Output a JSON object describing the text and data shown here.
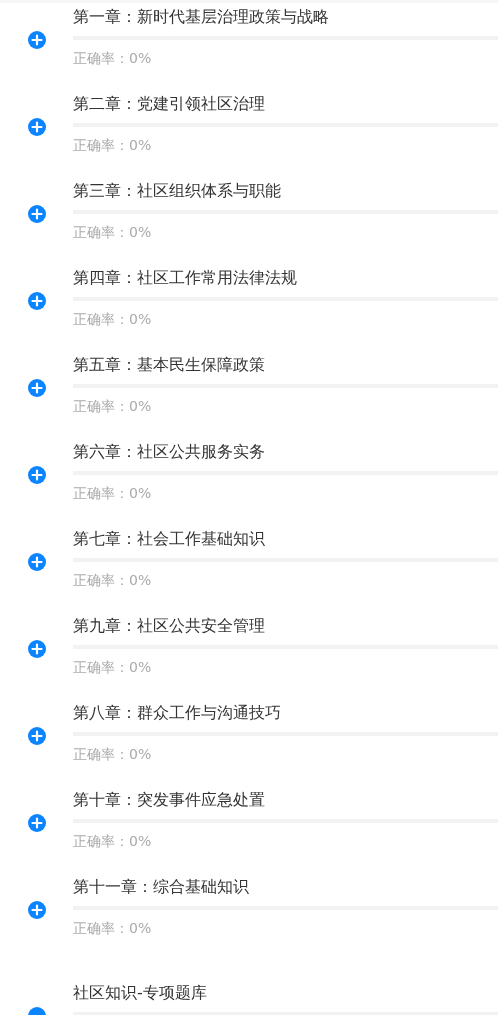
{
  "chapters": [
    {
      "kind": "plus",
      "title": "第一章：新时代基层治理政策与战略",
      "level": 0,
      "accuracy": "正确率：0%"
    },
    {
      "kind": "plus",
      "title": "第二章：党建引领社区治理",
      "level": 0,
      "accuracy": "正确率：0%"
    },
    {
      "kind": "plus",
      "title": "第三章：社区组织体系与职能",
      "level": 0,
      "accuracy": "正确率：0%"
    },
    {
      "kind": "plus",
      "title": "第四章：社区工作常用法律法规",
      "level": 0,
      "accuracy": "正确率：0%"
    },
    {
      "kind": "plus",
      "title": "第五章：基本民生保障政策",
      "level": 0,
      "accuracy": "正确率：0%"
    },
    {
      "kind": "plus",
      "title": "第六章：社区公共服务实务",
      "level": 0,
      "accuracy": "正确率：0%"
    },
    {
      "kind": "plus",
      "title": "第七章：社会工作基础知识",
      "level": 0,
      "accuracy": "正确率：0%"
    },
    {
      "kind": "plus",
      "title": "第九章：社区公共安全管理",
      "level": 0,
      "accuracy": "正确率：0%"
    },
    {
      "kind": "plus",
      "title": "第八章：群众工作与沟通技巧",
      "level": 0,
      "accuracy": "正确率：0%"
    },
    {
      "kind": "plus",
      "title": "第十章：突发事件应急处置",
      "level": 0,
      "accuracy": "正确率：0%"
    },
    {
      "kind": "plus",
      "title": "第十一章：综合基础知识",
      "level": 0,
      "accuracy": "正确率：0%"
    },
    {
      "kind": "dot",
      "title": "社区知识-专项题库",
      "level": 0
    }
  ]
}
